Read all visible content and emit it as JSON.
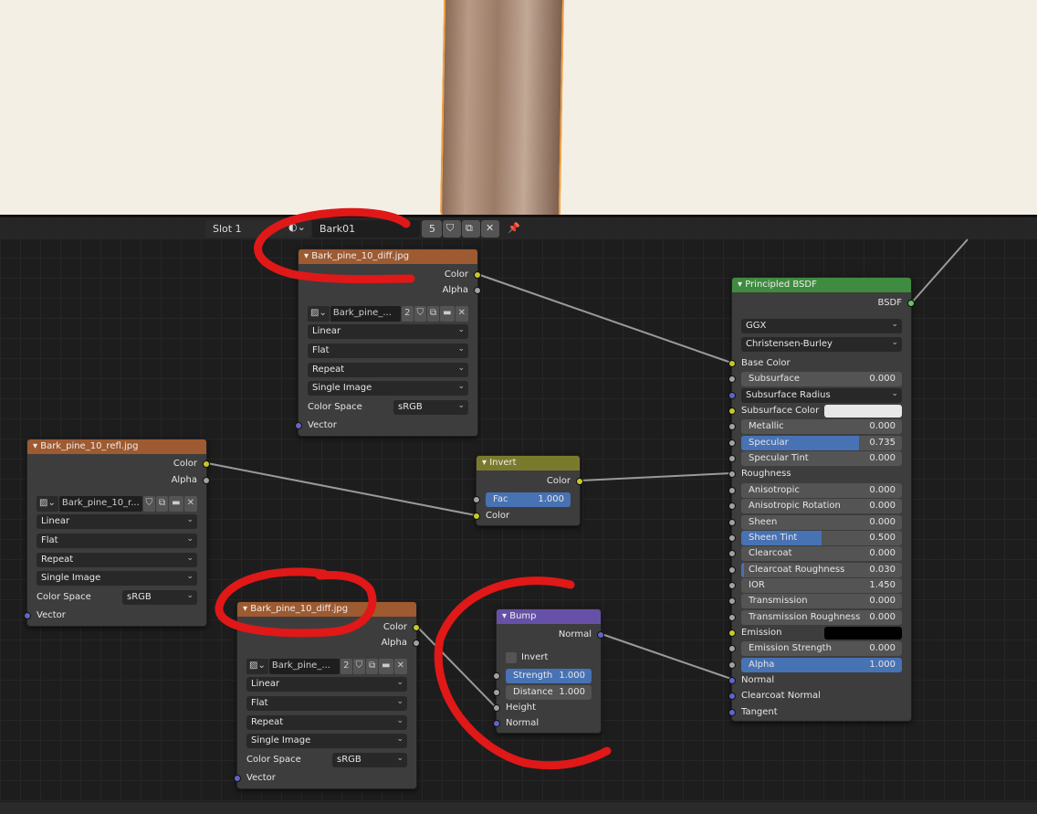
{
  "header": {
    "slot": "Slot 1",
    "material": "Bark01",
    "users": "5"
  },
  "colors": {
    "image": "#9e5a30",
    "converter": "#7a7a2c",
    "vector": "#6750a8",
    "shader": "#3f8b3f",
    "socket_color": "#c7c729",
    "socket_float": "#a1a1a1",
    "socket_vector": "#6363c7",
    "socket_shader": "#63c763",
    "annotation": "#e01818"
  },
  "nodes": [
    {
      "id": "diff_top",
      "title": "Bark_pine_10_diff.jpg",
      "kind": "image",
      "rows": [
        {
          "t": "out",
          "label": "Color",
          "s": "color"
        },
        {
          "t": "out",
          "label": "Alpha",
          "s": "float"
        },
        {
          "t": "image",
          "name": "Bark_pine_...",
          "users": "2"
        },
        {
          "t": "select",
          "value": "Linear"
        },
        {
          "t": "select",
          "value": "Flat"
        },
        {
          "t": "select",
          "value": "Repeat"
        },
        {
          "t": "select",
          "value": "Single Image"
        },
        {
          "t": "prop",
          "label": "Color Space",
          "value": "sRGB"
        },
        {
          "t": "in",
          "label": "Vector",
          "s": "vector"
        }
      ]
    },
    {
      "id": "refl",
      "title": "Bark_pine_10_refl.jpg",
      "kind": "image",
      "rows": [
        {
          "t": "out",
          "label": "Color",
          "s": "color"
        },
        {
          "t": "out",
          "label": "Alpha",
          "s": "float"
        },
        {
          "t": "image",
          "name": "Bark_pine_10_r...",
          "users": ""
        },
        {
          "t": "select",
          "value": "Linear"
        },
        {
          "t": "select",
          "value": "Flat"
        },
        {
          "t": "select",
          "value": "Repeat"
        },
        {
          "t": "select",
          "value": "Single Image"
        },
        {
          "t": "prop",
          "label": "Color Space",
          "value": "sRGB"
        },
        {
          "t": "in",
          "label": "Vector",
          "s": "vector"
        }
      ]
    },
    {
      "id": "diff_bottom",
      "title": "Bark_pine_10_diff.jpg",
      "kind": "image",
      "rows": [
        {
          "t": "out",
          "label": "Color",
          "s": "color"
        },
        {
          "t": "out",
          "label": "Alpha",
          "s": "float"
        },
        {
          "t": "image",
          "name": "Bark_pine_...",
          "users": "2"
        },
        {
          "t": "select",
          "value": "Linear"
        },
        {
          "t": "select",
          "value": "Flat"
        },
        {
          "t": "select",
          "value": "Repeat"
        },
        {
          "t": "select",
          "value": "Single Image"
        },
        {
          "t": "prop",
          "label": "Color Space",
          "value": "sRGB"
        },
        {
          "t": "in",
          "label": "Vector",
          "s": "vector"
        }
      ]
    },
    {
      "id": "invert",
      "title": "Invert",
      "kind": "converter",
      "rows": [
        {
          "t": "out",
          "label": "Color",
          "s": "color"
        },
        {
          "t": "field",
          "label": "Fac",
          "value": "1.000",
          "fraction": 1.0,
          "s": "float"
        },
        {
          "t": "in",
          "label": "Color",
          "s": "color"
        }
      ]
    },
    {
      "id": "bump",
      "title": "Bump",
      "kind": "vector",
      "rows": [
        {
          "t": "out",
          "label": "Normal",
          "s": "vector"
        },
        {
          "t": "check",
          "label": "Invert",
          "checked": false
        },
        {
          "t": "field",
          "label": "Strength",
          "value": "1.000",
          "fraction": 1.0,
          "s": "float"
        },
        {
          "t": "field",
          "label": "Distance",
          "value": "1.000",
          "fraction": 0,
          "s": "float"
        },
        {
          "t": "in",
          "label": "Height",
          "s": "float"
        },
        {
          "t": "in",
          "label": "Normal",
          "s": "vector"
        }
      ]
    },
    {
      "id": "principled",
      "title": "Principled BSDF",
      "kind": "shader",
      "rows": [
        {
          "t": "out",
          "label": "BSDF",
          "s": "shader"
        },
        {
          "t": "select",
          "value": "GGX"
        },
        {
          "t": "select",
          "value": "Christensen-Burley"
        },
        {
          "t": "in",
          "label": "Base Color",
          "s": "color"
        },
        {
          "t": "field",
          "label": "Subsurface",
          "value": "0.000",
          "fraction": 0,
          "s": "float"
        },
        {
          "t": "sockselect",
          "value": "Subsurface Radius",
          "s": "vector"
        },
        {
          "t": "color",
          "label": "Subsurface Color",
          "swatch": "#e8e8e8",
          "s": "color"
        },
        {
          "t": "field",
          "label": "Metallic",
          "value": "0.000",
          "fraction": 0,
          "s": "float"
        },
        {
          "t": "field",
          "label": "Specular",
          "value": "0.735",
          "fraction": 0.735,
          "s": "float"
        },
        {
          "t": "field",
          "label": "Specular Tint",
          "value": "0.000",
          "fraction": 0,
          "s": "float"
        },
        {
          "t": "in",
          "label": "Roughness",
          "s": "float"
        },
        {
          "t": "field",
          "label": "Anisotropic",
          "value": "0.000",
          "fraction": 0,
          "s": "float"
        },
        {
          "t": "field",
          "label": "Anisotropic Rotation",
          "value": "0.000",
          "fraction": 0,
          "s": "float"
        },
        {
          "t": "field",
          "label": "Sheen",
          "value": "0.000",
          "fraction": 0,
          "s": "float"
        },
        {
          "t": "field",
          "label": "Sheen Tint",
          "value": "0.500",
          "fraction": 0.5,
          "s": "float"
        },
        {
          "t": "field",
          "label": "Clearcoat",
          "value": "0.000",
          "fraction": 0,
          "s": "float"
        },
        {
          "t": "field",
          "label": "Clearcoat Roughness",
          "value": "0.030",
          "fraction": 0.03,
          "s": "float"
        },
        {
          "t": "field",
          "label": "IOR",
          "value": "1.450",
          "fraction": 0,
          "s": "float"
        },
        {
          "t": "field",
          "label": "Transmission",
          "value": "0.000",
          "fraction": 0,
          "s": "float"
        },
        {
          "t": "field",
          "label": "Transmission Roughness",
          "value": "0.000",
          "fraction": 0,
          "s": "float"
        },
        {
          "t": "color",
          "label": "Emission",
          "swatch": "#000000",
          "s": "color"
        },
        {
          "t": "field",
          "label": "Emission Strength",
          "value": "0.000",
          "fraction": 0,
          "s": "float"
        },
        {
          "t": "field",
          "label": "Alpha",
          "value": "1.000",
          "fraction": 1.0,
          "s": "float"
        },
        {
          "t": "in",
          "label": "Normal",
          "s": "vector"
        },
        {
          "t": "in",
          "label": "Clearcoat Normal",
          "s": "vector"
        },
        {
          "t": "in",
          "label": "Tangent",
          "s": "vector"
        }
      ]
    }
  ]
}
